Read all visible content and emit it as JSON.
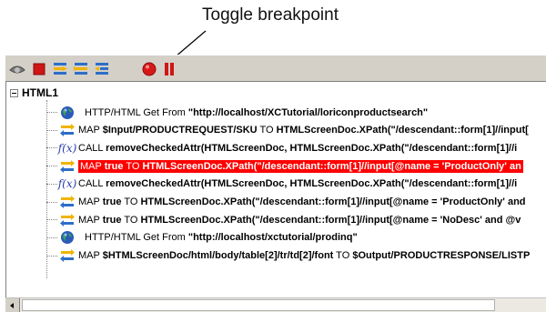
{
  "callout": {
    "label": "Toggle breakpoint"
  },
  "toolbar": {
    "buttons": [
      {
        "icon": "eye-icon",
        "color": "#6e6e6e"
      },
      {
        "icon": "stop-icon",
        "color": "#cc1111"
      },
      {
        "icon": "step-into-icon",
        "color": "#2d6ec8"
      },
      {
        "icon": "step-over-icon",
        "color": "#2d6ec8"
      },
      {
        "icon": "step-out-icon",
        "color": "#2d6ec8"
      },
      {
        "icon": "breakpoint-icon",
        "color": "#d81818"
      },
      {
        "icon": "pause-icon",
        "color": "#cc1111"
      }
    ]
  },
  "tree": {
    "root_label": "HTML1",
    "rows": [
      {
        "type": "http",
        "icon": "globe-icon",
        "prefix": "HTTP/HTML Get From ",
        "bold": "\"http://localhost/XCTutorial/loriconproductsearch\"",
        "mid": "",
        "bold2": ""
      },
      {
        "type": "map",
        "icon": "map-arrows-icon",
        "prefix": "MAP ",
        "bold": "$Input/PRODUCTREQUEST/SKU",
        "mid": " TO ",
        "bold2": "HTMLScreenDoc.XPath(\"/descendant::form[1]//input["
      },
      {
        "type": "call",
        "icon": "function-icon",
        "prefix": "CALL ",
        "bold": "removeCheckedAttr(HTMLScreenDoc, HTMLScreenDoc.XPath(\"/descendant::form[1]//i",
        "mid": "",
        "bold2": ""
      },
      {
        "type": "map",
        "icon": "map-arrows-icon",
        "selected": true,
        "prefix": "MAP ",
        "bold": "true",
        "mid": " TO ",
        "bold2": "HTMLScreenDoc.XPath(\"/descendant::form[1]//input[@name = 'ProductOnly' an"
      },
      {
        "type": "call",
        "icon": "function-icon",
        "prefix": "CALL ",
        "bold": "removeCheckedAttr(HTMLScreenDoc, HTMLScreenDoc.XPath(\"/descendant::form[1]//i",
        "mid": "",
        "bold2": ""
      },
      {
        "type": "map",
        "icon": "map-arrows-icon",
        "prefix": "MAP ",
        "bold": "true",
        "mid": " TO ",
        "bold2": "HTMLScreenDoc.XPath(\"/descendant::form[1]//input[@name = 'ProductOnly' and"
      },
      {
        "type": "map",
        "icon": "map-arrows-icon",
        "prefix": "MAP ",
        "bold": "true",
        "mid": " TO ",
        "bold2": "HTMLScreenDoc.XPath(\"/descendant::form[1]//input[@name = 'NoDesc' and @v"
      },
      {
        "type": "http",
        "icon": "globe-icon",
        "prefix": "HTTP/HTML Get From ",
        "bold": "\"http://localhost/xctutorial/prodinq\"",
        "mid": "",
        "bold2": ""
      },
      {
        "type": "map",
        "icon": "map-arrows-icon",
        "prefix": "MAP ",
        "bold": "$HTMLScreenDoc/html/body/table[2]/tr/td[2]/font",
        "mid": " TO ",
        "bold2": "$Output/PRODUCTRESPONSE/LISTP"
      }
    ]
  },
  "colors": {
    "selection": "#ff0000",
    "toolbar_bg": "#d4d0c8"
  }
}
